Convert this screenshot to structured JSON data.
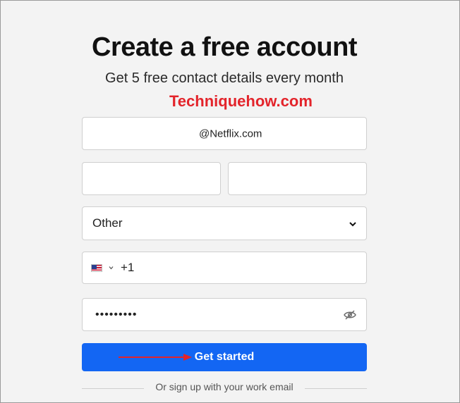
{
  "header": {
    "title": "Create a free account",
    "subtitle": "Get 5 free contact details every month"
  },
  "watermark": "Techniquehow.com",
  "form": {
    "email_value": "@Netflix.com",
    "first_name_value": "",
    "last_name_value": "",
    "role_value": "Other",
    "phone_country": "us-flag-icon",
    "phone_prefix": "+1",
    "password_value": "•••••••••",
    "submit_label": "Get started",
    "alt_signup_text": "Or sign up with your work email"
  },
  "colors": {
    "accent": "#1366f3",
    "watermark": "#e3242b",
    "annotation_arrow": "#e3242b"
  }
}
